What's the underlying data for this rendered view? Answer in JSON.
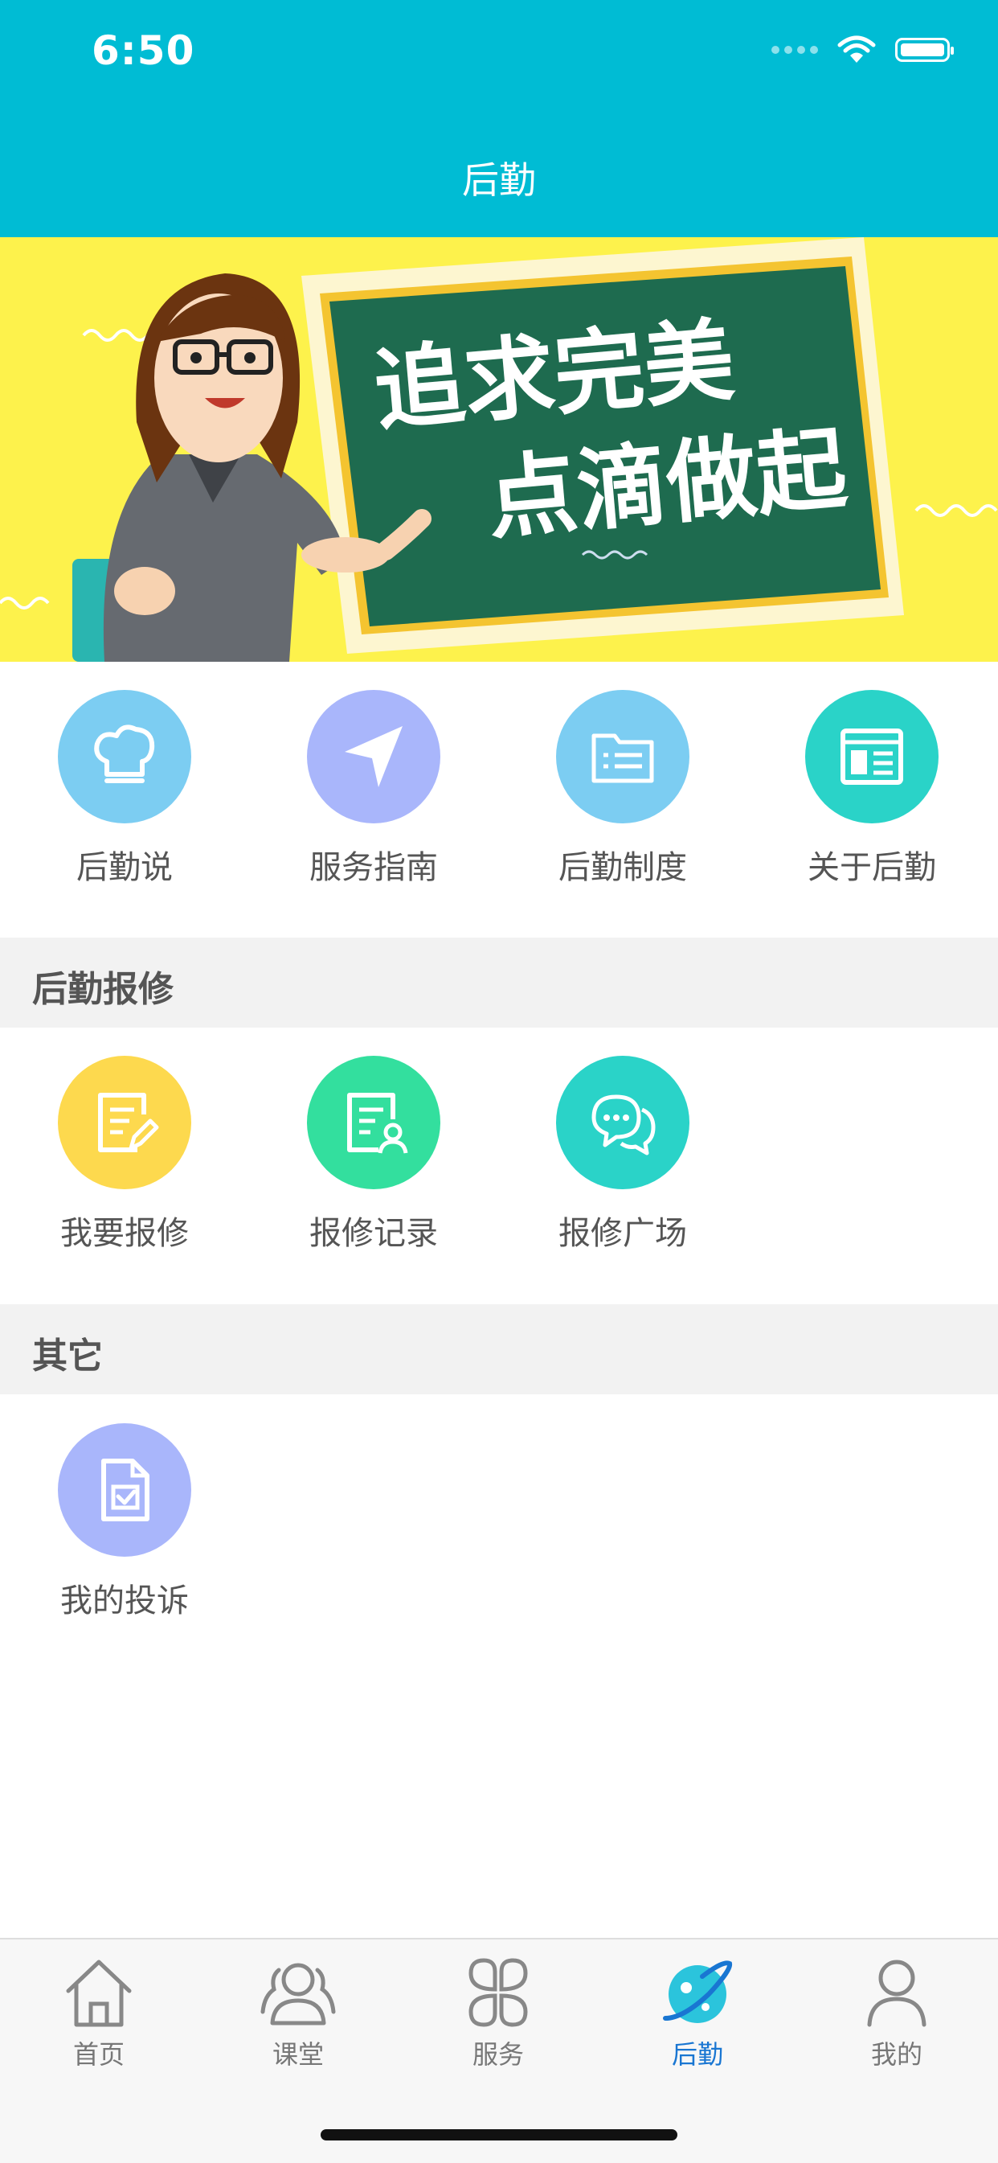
{
  "status_bar": {
    "time": "6:50"
  },
  "header": {
    "title": "后勤"
  },
  "banner": {
    "line1": "追求完美",
    "line2": "点滴做起"
  },
  "top_grid": [
    {
      "label": "后勤说",
      "icon": "chef-hat-icon",
      "color": "#7ccdf2"
    },
    {
      "label": "服务指南",
      "icon": "navigation-arrow-icon",
      "color": "#a9b6fb"
    },
    {
      "label": "后勤制度",
      "icon": "folder-list-icon",
      "color": "#7ccdf2"
    },
    {
      "label": "关于后勤",
      "icon": "newspaper-icon",
      "color": "#2ad3c8"
    }
  ],
  "repair_section": {
    "title": "后勤报修",
    "items": [
      {
        "label": "我要报修",
        "icon": "edit-document-icon",
        "color": "#fdd94e"
      },
      {
        "label": "报修记录",
        "icon": "document-user-icon",
        "color": "#33df9e"
      },
      {
        "label": "报修广场",
        "icon": "chat-bubbles-icon",
        "color": "#2ad3c8"
      }
    ]
  },
  "other_section": {
    "title": "其它",
    "items": [
      {
        "label": "我的投诉",
        "icon": "file-check-icon",
        "color": "#a9b6fb"
      }
    ]
  },
  "tabbar": {
    "active_color": "#1976d2",
    "items": [
      {
        "label": "首页",
        "icon": "home-icon"
      },
      {
        "label": "课堂",
        "icon": "users-icon"
      },
      {
        "label": "服务",
        "icon": "grid-clover-icon"
      },
      {
        "label": "后勤",
        "icon": "planet-icon",
        "active": true
      },
      {
        "label": "我的",
        "icon": "person-icon"
      }
    ]
  }
}
